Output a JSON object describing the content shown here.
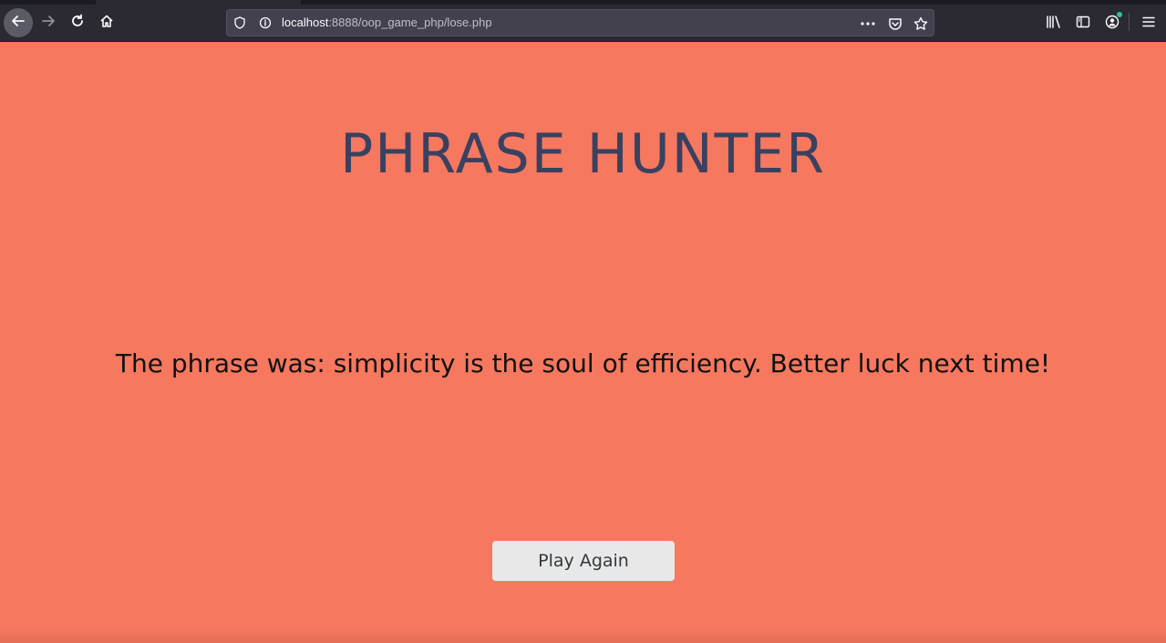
{
  "browser": {
    "url_host": "localhost",
    "url_rest": ":8888/oop_game_php/lose.php",
    "icons": {
      "back": "arrow-left-icon",
      "forward": "arrow-right-icon",
      "reload": "reload-icon",
      "home": "home-icon",
      "shield": "shield-icon",
      "info": "info-icon",
      "more": "more-icon",
      "pocket": "pocket-icon",
      "bookmark": "star-icon",
      "library": "library-icon",
      "sidebar": "sidebar-icon",
      "account": "account-icon",
      "menu": "hamburger-menu-icon"
    }
  },
  "page": {
    "title": "PHRASE HUNTER",
    "message": "The phrase was: simplicity is the soul of efficiency. Better luck next time!",
    "button_label": "Play Again"
  },
  "colors": {
    "background": "#f6785f",
    "title": "#3a4160",
    "button_bg": "#e8e8e8"
  }
}
